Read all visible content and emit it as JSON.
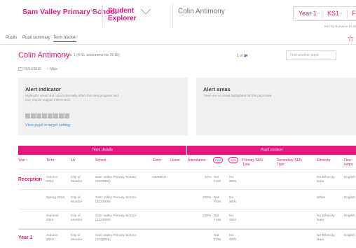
{
  "header": {
    "school": "Sam Valley Primary School",
    "crumb2_line1": "Student",
    "crumb2_line2": "Explorer",
    "crumb3": "Colin Antimony",
    "year_tabs": [
      "Year 1",
      "KS1",
      "F"
    ],
    "sort_text": "Sort by Surname (A-Z)"
  },
  "tabs": [
    "Pupils",
    "Pupil summary",
    "Term tracker"
  ],
  "pupil": {
    "name": "Colin Antimony",
    "subtitle": "Year 1 (KS1 assessments 2018)",
    "pager": "1 of 24",
    "search_placeholder": "Find another pupil",
    "dob": "09/11/2010",
    "gender": "Male"
  },
  "alert_indicator": {
    "title": "Alert indicator",
    "desc_line1": "Highlights areas that could potentially affect this area progress and",
    "desc_line2": "may require support intervention.",
    "link": "View pupil in target setting"
  },
  "alert_areas": {
    "title": "Alert areas",
    "desc": "There are no areas highlighted for this pupil area"
  },
  "table": {
    "group_term": "Term details",
    "group_pupil": "Pupil context",
    "columns": {
      "year": "Year",
      "term": "Term",
      "la": "LA",
      "school": "School",
      "entry": "Entry",
      "leave": "Leave",
      "attendance": "Attendance",
      "fsm": "FSM",
      "sen": "SEN",
      "primary_sen_1": "Primary SEN",
      "primary_sen_2": "Type",
      "secondary_sen_1": "Secondary SEN",
      "secondary_sen_2": "Type",
      "ethnicity": "Ethnicity",
      "first_lang_1": "First",
      "first_lang_2": "langu"
    },
    "rows": [
      {
        "year": "Reception",
        "term1": "Autumn",
        "term2": "2015",
        "la1": "City of",
        "la2": "Mondor",
        "school1": "Sam Valley Primary School",
        "school2": "(2222900)",
        "entry": "02/09/15",
        "attendance": "92%",
        "fsm1": "Not",
        "fsm2": "FSM",
        "sen1": "No",
        "sen2": "SEN",
        "eth1": "No Ethnicity",
        "eth2": "Data",
        "lang": "English"
      },
      {
        "year": "",
        "term1": "Spring 2016",
        "term2": "",
        "la1": "City of",
        "la2": "Mondor",
        "school1": "Sam Valley Primary School",
        "school2": "(2222900)",
        "entry": "",
        "attendance": "100%",
        "fsm1": "Not",
        "fsm2": "FSM",
        "sen1": "No",
        "sen2": "SEN",
        "eth1": "White",
        "eth2": "",
        "lang": "English"
      },
      {
        "year": "",
        "term1": "Summer",
        "term2": "2016",
        "la1": "City of",
        "la2": "Mondor",
        "school1": "Sam Valley Primary School",
        "school2": "(2222900)",
        "entry": "",
        "attendance": "100%",
        "fsm1": "Not",
        "fsm2": "FSM",
        "sen1": "No",
        "sen2": "SEN",
        "eth1": "No Ethnicity",
        "eth2": "Data",
        "lang": "English"
      },
      {
        "year": "Year 1",
        "term1": "Autumn",
        "term2": "2016",
        "la1": "City of",
        "la2": "Mondor",
        "school1": "Sam Valley Primary School",
        "school2": "(2222900)",
        "entry": "",
        "attendance": "",
        "fsm1": "Not",
        "fsm2": "FSM",
        "sen1": "No",
        "sen2": "SEN",
        "eth1": "No Ethnicity",
        "eth2": "Data",
        "lang": "English"
      }
    ]
  },
  "colors": {
    "accent": "#e0197d",
    "link": "#3a8bd6",
    "panel": "#f0f0f0"
  }
}
